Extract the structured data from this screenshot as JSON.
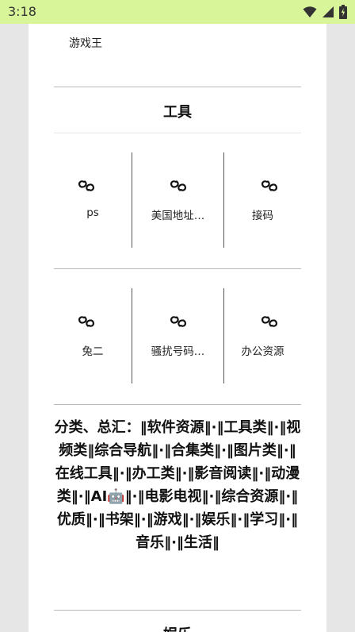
{
  "status_bar": {
    "time": "3:18"
  },
  "previous_section": {
    "last_item": "游戏王"
  },
  "tools_section": {
    "title": "工具",
    "rows": [
      [
        {
          "label": "ps",
          "icon": "link-icon"
        },
        {
          "label": "美国地址…",
          "icon": "link-icon"
        },
        {
          "label": "接码",
          "icon": "link-icon"
        }
      ],
      [
        {
          "label": "兔二",
          "icon": "link-icon"
        },
        {
          "label": "骚扰号码…",
          "icon": "link-icon"
        },
        {
          "label": "办公资源",
          "icon": "link-icon"
        }
      ]
    ]
  },
  "categories": {
    "text": "分类、总汇：‖软件资源‖·‖工具类‖·‖视频类‖综合导航‖·‖合集类‖·‖图片类‖·‖在线工具‖·‖办工类‖·‖影音阅读‖·‖动漫类‖·‖AI🤖‖·‖电影电视‖·‖综合资源‖·‖优质‖·‖书架‖·‖游戏‖·‖娱乐‖·‖学习‖·‖音乐‖·‖生活‖"
  },
  "next_section": {
    "title": "娱乐"
  },
  "colors": {
    "status_bar_bg": "#d8f59a",
    "page_bg": "#e6e6e6",
    "card_bg": "#ffffff"
  }
}
